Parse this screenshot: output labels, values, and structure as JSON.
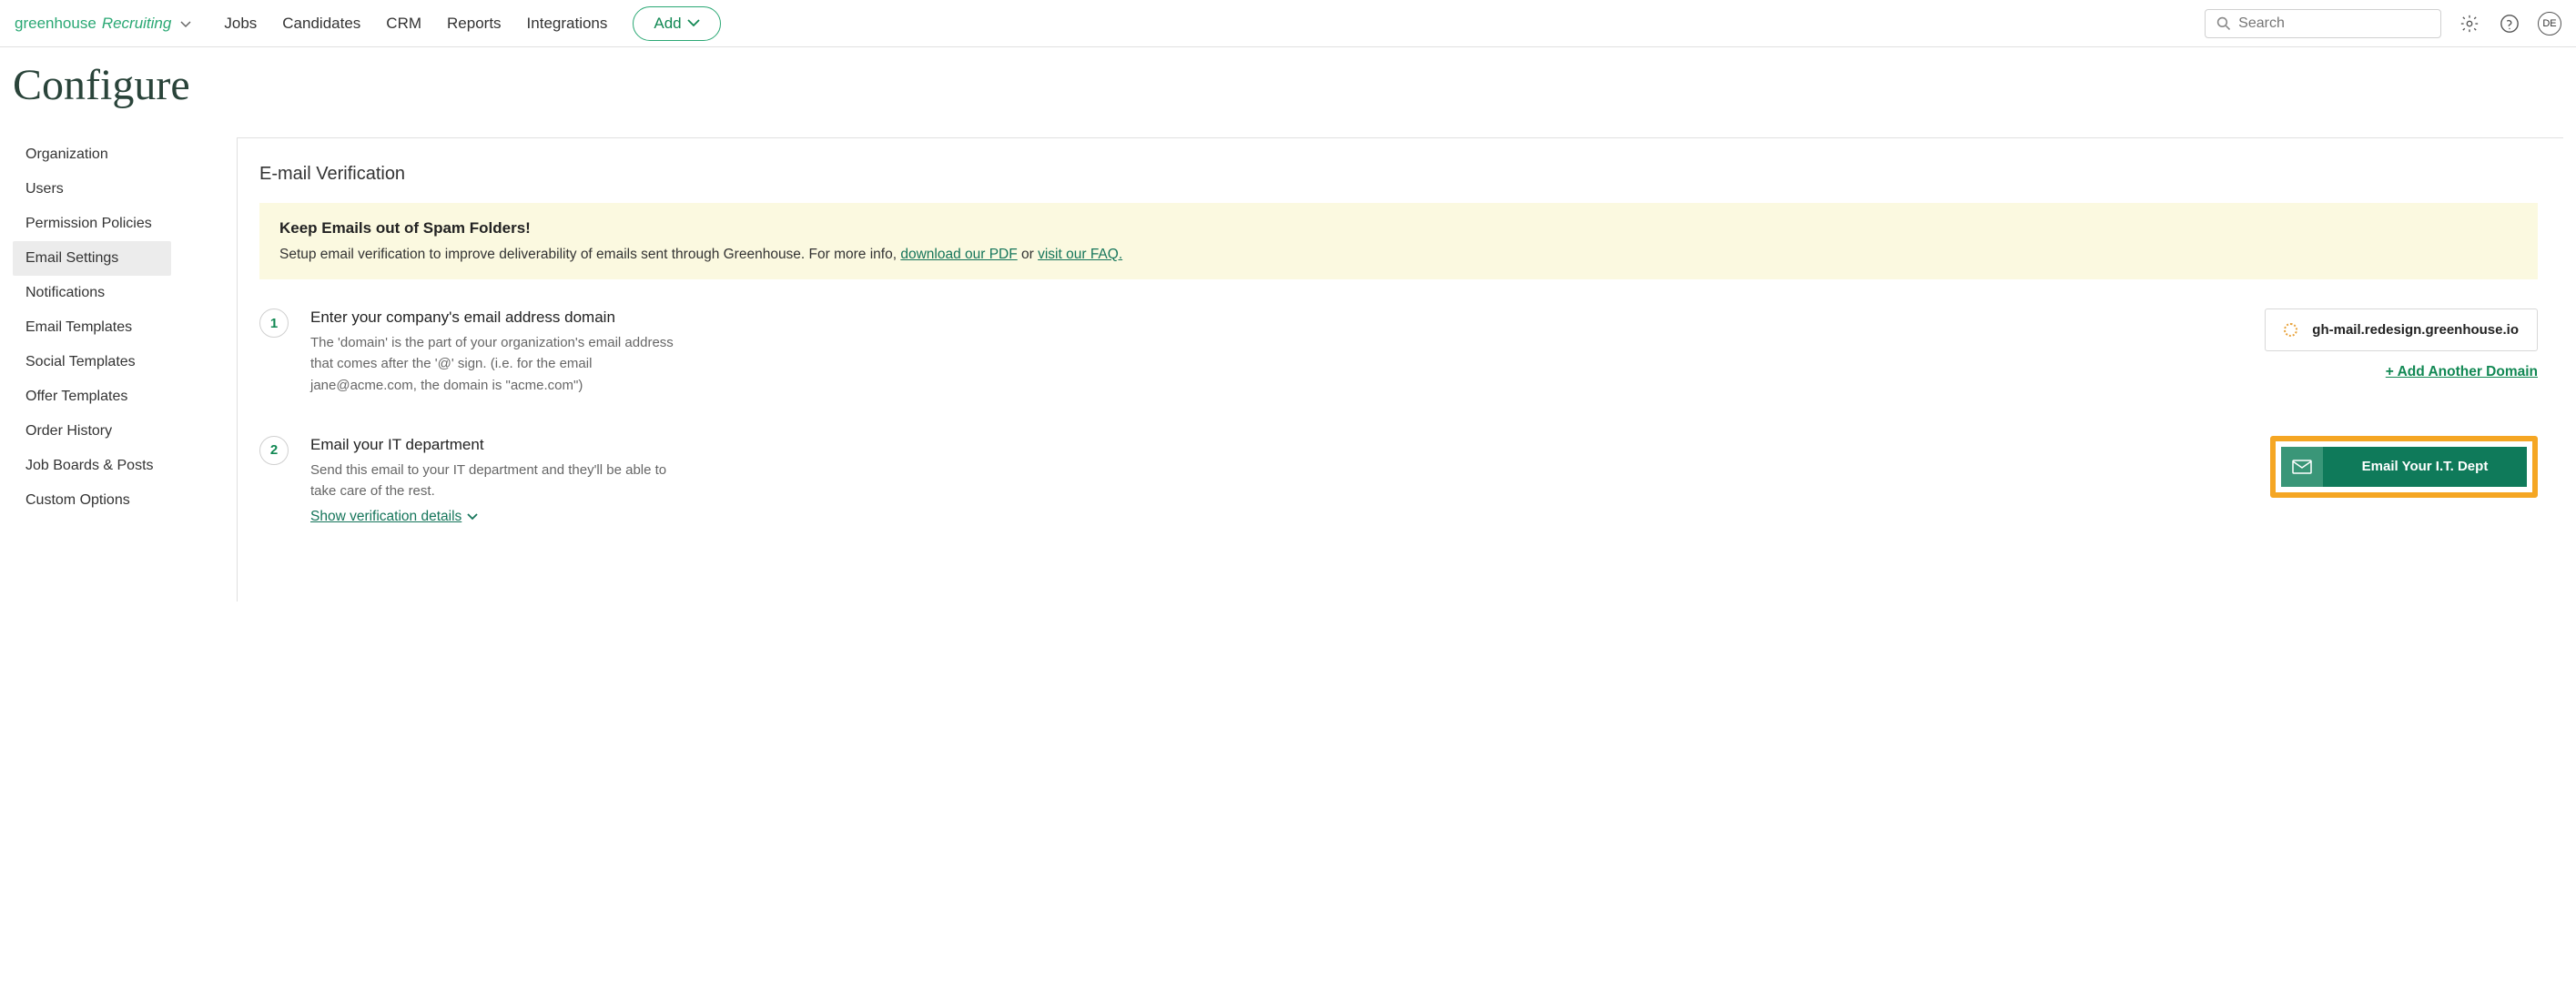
{
  "topnav": {
    "logo_primary": "greenhouse",
    "logo_secondary": "Recruiting",
    "links": [
      "Jobs",
      "Candidates",
      "CRM",
      "Reports",
      "Integrations"
    ],
    "add_label": "Add",
    "search_placeholder": "Search",
    "avatar_initials": "DE"
  },
  "page": {
    "title": "Configure"
  },
  "sidebar": {
    "items": [
      "Organization",
      "Users",
      "Permission Policies",
      "Email Settings",
      "Notifications",
      "Email Templates",
      "Social Templates",
      "Offer Templates",
      "Order History",
      "Job Boards & Posts",
      "Custom Options"
    ],
    "active_index": 3
  },
  "verification": {
    "section_title": "E-mail Verification",
    "info_title": "Keep Emails out of Spam Folders!",
    "info_text_pre": "Setup email verification to improve deliverability of emails sent through Greenhouse. For more info, ",
    "info_link_pdf": "download our PDF",
    "info_text_mid": " or ",
    "info_link_faq": "visit our FAQ.",
    "steps": [
      {
        "num": "1",
        "title": "Enter your company's email address domain",
        "desc": "The 'domain' is the part of your organization's email address that comes after the '@' sign. (i.e. for the email jane@acme.com, the domain is \"acme.com\")",
        "domain_value": "gh-mail.redesign.greenhouse.io",
        "add_domain_label": "+ Add Another Domain"
      },
      {
        "num": "2",
        "title": "Email your IT department",
        "desc": "Send this email to your IT department and they'll be able to take care of the rest.",
        "show_details_label": "Show verification details ",
        "email_it_label": "Email Your I.T. Dept"
      }
    ]
  }
}
